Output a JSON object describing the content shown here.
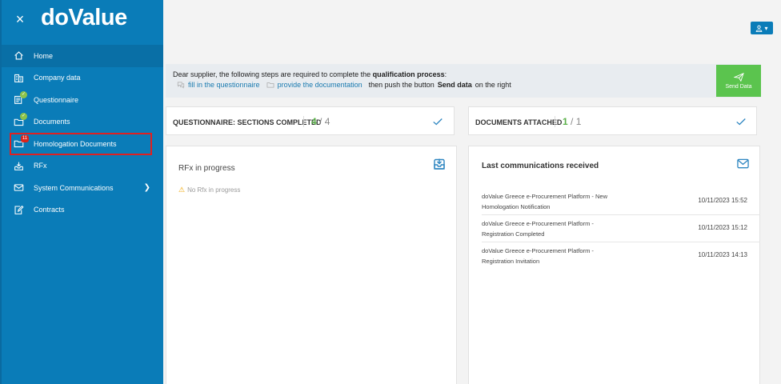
{
  "sidebar": {
    "logo": "doValue",
    "close_glyph": "×",
    "items": [
      {
        "label": "Home",
        "icon": "home-icon"
      },
      {
        "label": "Company data",
        "icon": "building-icon"
      },
      {
        "label": "Questionnaire",
        "icon": "questionnaire-icon",
        "badge": "✓"
      },
      {
        "label": "Documents",
        "icon": "folder-icon",
        "badge": "✓"
      },
      {
        "label": "Homologation Documents",
        "icon": "folder-icon",
        "badge": "11"
      },
      {
        "label": "RFx",
        "icon": "inbox-download-icon"
      },
      {
        "label": "System Communications",
        "icon": "envelope-icon"
      },
      {
        "label": "Contracts",
        "icon": "contract-edit-icon"
      }
    ]
  },
  "topbar": {
    "user_icon": "user-icon"
  },
  "infobar": {
    "line1_pre": "Dear supplier, the following steps are required to complete the ",
    "line1_bold": "qualification process",
    "line1_post": ":",
    "step1_link": "fill in the questionnaire",
    "step2_link": "provide the documentation",
    "line2_mid": "then push the button ",
    "line2_bold": "Send data",
    "line2_post": " on the right",
    "send_button": "Send Data"
  },
  "cards": {
    "questionnaire": {
      "title": "QUESTIONNAIRE: SECTIONS COMPLETED",
      "done": "4",
      "sep": "/",
      "total": "4"
    },
    "documents": {
      "title": "DOCUMENTS ATTACHED",
      "done": "1",
      "sep": "/",
      "total": "1"
    }
  },
  "rfx": {
    "title": "RFx in progress",
    "empty": "No Rfx in progress"
  },
  "communications": {
    "title": "Last communications received",
    "rows": [
      {
        "subject_line1": "doValue Greece e-Procurement Platform - New",
        "subject_line2": "Homologation Notification",
        "date": "10/11/2023 15:52"
      },
      {
        "subject_line1": "doValue Greece e-Procurement Platform -",
        "subject_line2": "Registration Completed",
        "date": "10/11/2023 15:12"
      },
      {
        "subject_line1": "doValue Greece e-Procurement Platform -",
        "subject_line2": "Registration Invitation",
        "date": "10/11/2023 14:13"
      }
    ]
  },
  "colors": {
    "sidebar": "#0a7cb8",
    "accent_green": "#5bc44e",
    "link": "#1b7bb0",
    "highlight": "#e02020"
  }
}
